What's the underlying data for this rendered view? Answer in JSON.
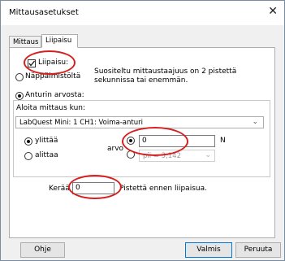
{
  "window": {
    "title": "Mittausasetukset",
    "close_symbol": "✕"
  },
  "tabs": [
    {
      "label": "Mittaus"
    },
    {
      "label": "Liipaisu"
    }
  ],
  "trigger": {
    "checkbox_label": "Liipaisu:",
    "keypress_label": "Näppäimistöltä",
    "note_line1": "Suositeltu mittaustaajuus on 2 pistettä",
    "note_line2": "sekunnissa tai enemmän.",
    "sensor_label": "Anturin arvosta:",
    "start_group_label": "Aloita mittaus kun:",
    "sensor_select": "LabQuest Mini: 1 CH1: Voima-anturi",
    "exceeds_label": "ylittää",
    "below_label": "alittaa",
    "value_label": "arvo",
    "value": "0",
    "unit": "N",
    "pi_select": "pii = 3,142"
  },
  "collect": {
    "label_before": "Kerää",
    "value": "0",
    "label_after": "Pistettä ennen liipaisua."
  },
  "buttons": {
    "help": "Ohje",
    "ok": "Valmis",
    "cancel": "Peruuta"
  }
}
